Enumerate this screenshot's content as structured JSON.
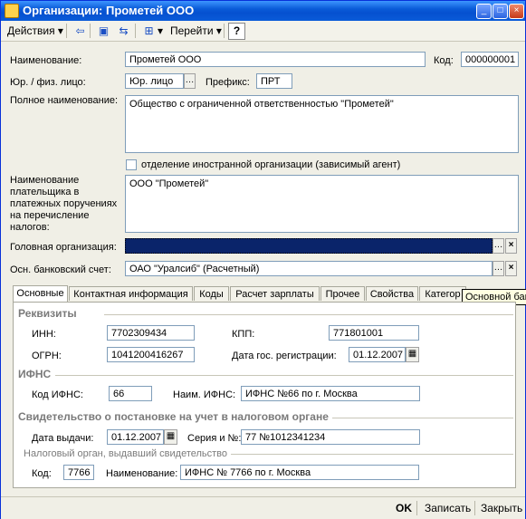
{
  "window": {
    "title": "Организации: Прометей ООО"
  },
  "toolbar": {
    "actions": "Действия",
    "go": "Перейти",
    "help": "?"
  },
  "form": {
    "name_label": "Наименование:",
    "name_value": "Прометей ООО",
    "code_label": "Код:",
    "code_value": "000000001",
    "type_label": "Юр. / физ. лицо:",
    "type_value": "Юр. лицо",
    "prefix_label": "Префикс:",
    "prefix_value": "ПРТ",
    "fullname_label": "Полное наименование:",
    "fullname_value": "Общество с ограниченной ответственностью \"Прометей\"",
    "foreign_label": "отделение иностранной организации (зависимый агент)",
    "payer_label_1": "Наименование",
    "payer_label_2": "плательщика в",
    "payer_label_3": "платежных поручениях",
    "payer_label_4": "на перечисление",
    "payer_label_5": "налогов:",
    "payer_value": "ООО \"Прометей\"",
    "head_label": "Головная организация:",
    "bank_label": "Осн. банковский счет:",
    "bank_value": "ОАО \"Уралсиб\" (Расчетный)"
  },
  "tabs": [
    "Основные",
    "Контактная информация",
    "Коды",
    "Расчет зарплаты",
    "Прочее",
    "Свойства",
    "Категор"
  ],
  "tooltip": "Основной банк",
  "main": {
    "requisites": "Реквизиты",
    "inn_label": "ИНН:",
    "inn_value": "7702309434",
    "kpp_label": "КПП:",
    "kpp_value": "771801001",
    "ogrn_label": "ОГРН:",
    "ogrn_value": "1041200416267",
    "regdate_label": "Дата гос. регистрации:",
    "regdate_value": "01.12.2007",
    "ifns_title": "ИФНС",
    "ifns_code_label": "Код ИФНС:",
    "ifns_code_value": "66",
    "ifns_name_label": "Наим. ИФНС:",
    "ifns_name_value": "ИФНС №66 по г. Москва",
    "cert_title": "Свидетельство о постановке на учет в налоговом органе",
    "issue_label": "Дата выдачи:",
    "issue_value": "01.12.2007",
    "series_label": "Серия и №:",
    "series_value": "77 №1012341234",
    "issuer_title": "Налоговый орган, выдавший свидетельство",
    "issuer_code_label": "Код:",
    "issuer_code_value": "7766",
    "issuer_name_label": "Наименование:",
    "issuer_name_value": "ИФНС № 7766 по г. Москва"
  },
  "footer": {
    "ok": "OK",
    "save": "Записать",
    "close": "Закрыть"
  }
}
